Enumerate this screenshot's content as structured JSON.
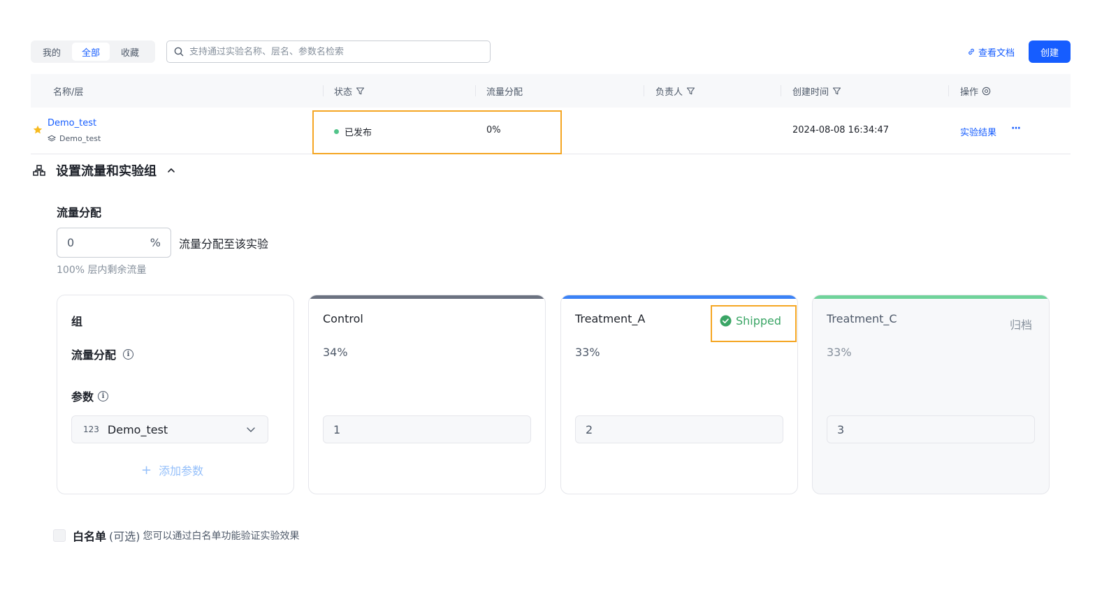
{
  "toolbar": {
    "tabs": [
      "我的",
      "全部",
      "收藏"
    ],
    "active_tab": "全部",
    "search_placeholder": "支持通过实验名称、层名、参数名检索",
    "doc_link": "查看文档",
    "create_button": "创建"
  },
  "table": {
    "columns": [
      "名称/层",
      "状态",
      "流量分配",
      "负责人",
      "创建时间",
      "操作"
    ],
    "rows": [
      {
        "name": "Demo_test",
        "layer": "Demo_test",
        "status": "已发布",
        "traffic": "0%",
        "owner": "",
        "created_at": "2024-08-08 16:34:47",
        "action": "实验结果",
        "more": "···"
      }
    ]
  },
  "section": {
    "title": "设置流量和实验组",
    "traffic_label": "流量分配",
    "traffic_value": "0",
    "traffic_unit": "%",
    "traffic_suffix": "流量分配至该实验",
    "remaining_note": "100% 层内剩余流量"
  },
  "groups_header": {
    "group_label": "组",
    "traffic_label": "流量分配",
    "params_label": "参数",
    "param_name": "Demo_test",
    "param_type_glyph": "123",
    "add_param": "添加参数"
  },
  "groups": [
    {
      "name": "Control",
      "traffic": "34%",
      "value": "1",
      "badge": "",
      "bar_color": "#6b7280"
    },
    {
      "name": "Treatment_A",
      "traffic": "33%",
      "value": "2",
      "badge": "Shipped",
      "bar_color": "#3b82f6"
    },
    {
      "name": "Treatment_C",
      "traffic": "33%",
      "value": "3",
      "badge": "归档",
      "bar_color": "#6fd39a"
    }
  ],
  "whitelist": {
    "title": "白名单",
    "optional": "(可选)",
    "description": "您可以通过白名单功能验证实验效果"
  },
  "colors": {
    "accent": "#165dff",
    "highlight": "#f5a623",
    "status_published": "#52c48a",
    "shipped": "#3aa565"
  }
}
